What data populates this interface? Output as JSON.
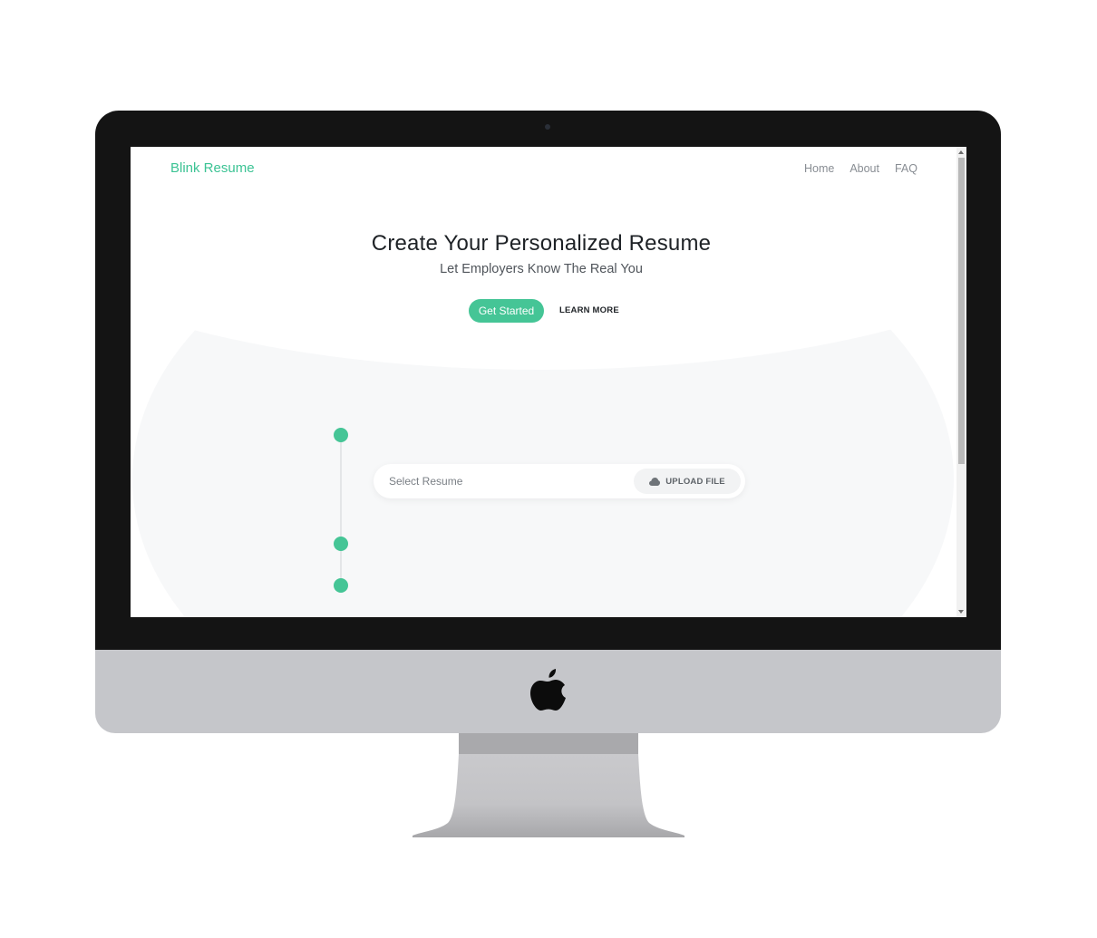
{
  "brand": {
    "name": "Blink Resume",
    "color": "#3cc394"
  },
  "nav": {
    "items": [
      "Home",
      "About",
      "FAQ"
    ]
  },
  "hero": {
    "title": "Create Your Personalized Resume",
    "subtitle": "Let Employers Know The Real You",
    "primary_button": "Get Started",
    "secondary_button": "LEARN MORE"
  },
  "upload": {
    "placeholder": "Select Resume",
    "button_label": "UPLOAD FILE",
    "button_icon": "cloud-icon"
  },
  "stepper": {
    "steps": 3,
    "accent": "#45c596"
  },
  "device": {
    "logo_icon": "apple-logo-icon"
  }
}
